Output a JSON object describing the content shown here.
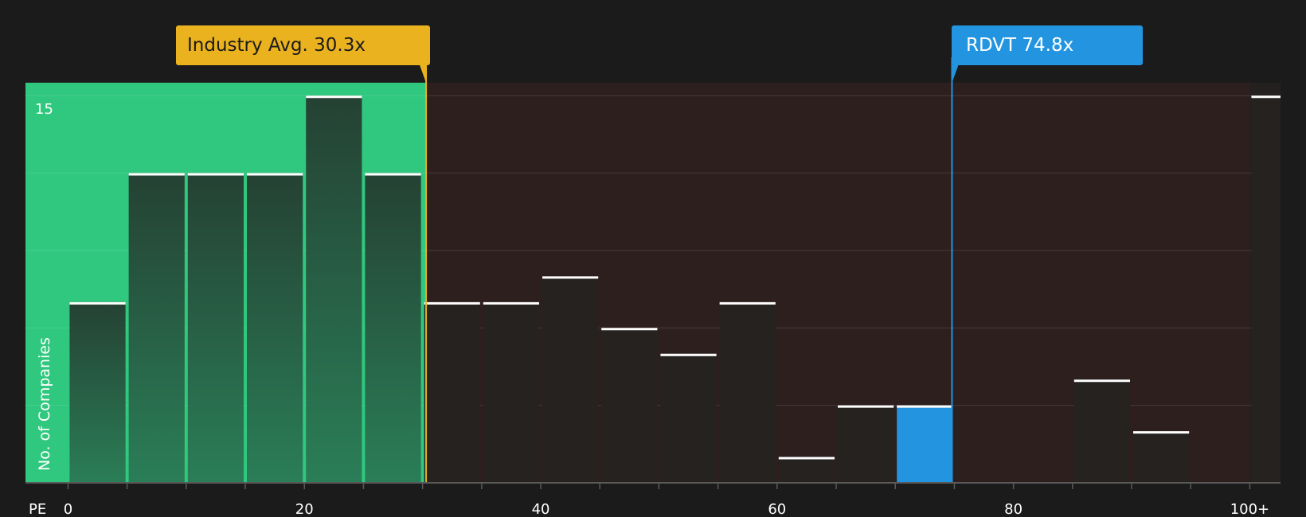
{
  "chart_data": {
    "type": "bar",
    "ylabel": "No. of Companies",
    "xlabel": "PE",
    "x_ticks": [
      "0",
      "20",
      "40",
      "60",
      "80",
      "100+"
    ],
    "y_tick": "15",
    "ylim": [
      0,
      15.5
    ],
    "xlim": [
      -3.6,
      102.6
    ],
    "bin_width": 5,
    "bins": [
      {
        "from": 0,
        "value": 7
      },
      {
        "from": 5,
        "value": 12
      },
      {
        "from": 10,
        "value": 12
      },
      {
        "from": 15,
        "value": 12
      },
      {
        "from": 20,
        "value": 15
      },
      {
        "from": 25,
        "value": 12
      },
      {
        "from": 30,
        "value": 7
      },
      {
        "from": 35,
        "value": 7
      },
      {
        "from": 40,
        "value": 8
      },
      {
        "from": 45,
        "value": 6
      },
      {
        "from": 50,
        "value": 5
      },
      {
        "from": 55,
        "value": 7
      },
      {
        "from": 60,
        "value": 1
      },
      {
        "from": 65,
        "value": 3
      },
      {
        "from": 70,
        "value": 3,
        "highlight": true
      },
      {
        "from": 75,
        "value": 0
      },
      {
        "from": 80,
        "value": 0
      },
      {
        "from": 85,
        "value": 4
      },
      {
        "from": 90,
        "value": 2
      },
      {
        "from": 100,
        "value": 15
      }
    ],
    "markers": {
      "industry_avg": {
        "label": "Industry Avg. 30.3x",
        "value": 30.3,
        "color": "#eab21e"
      },
      "company": {
        "label": "RDVT 74.8x",
        "value": 74.8,
        "color": "#2394e0"
      }
    },
    "grid": true,
    "colors": {
      "below_avg_region": "#2fc87e",
      "above_avg_region": "#2e1f1f",
      "bar": "#252220",
      "highlight_bar": "#2394e0"
    }
  }
}
